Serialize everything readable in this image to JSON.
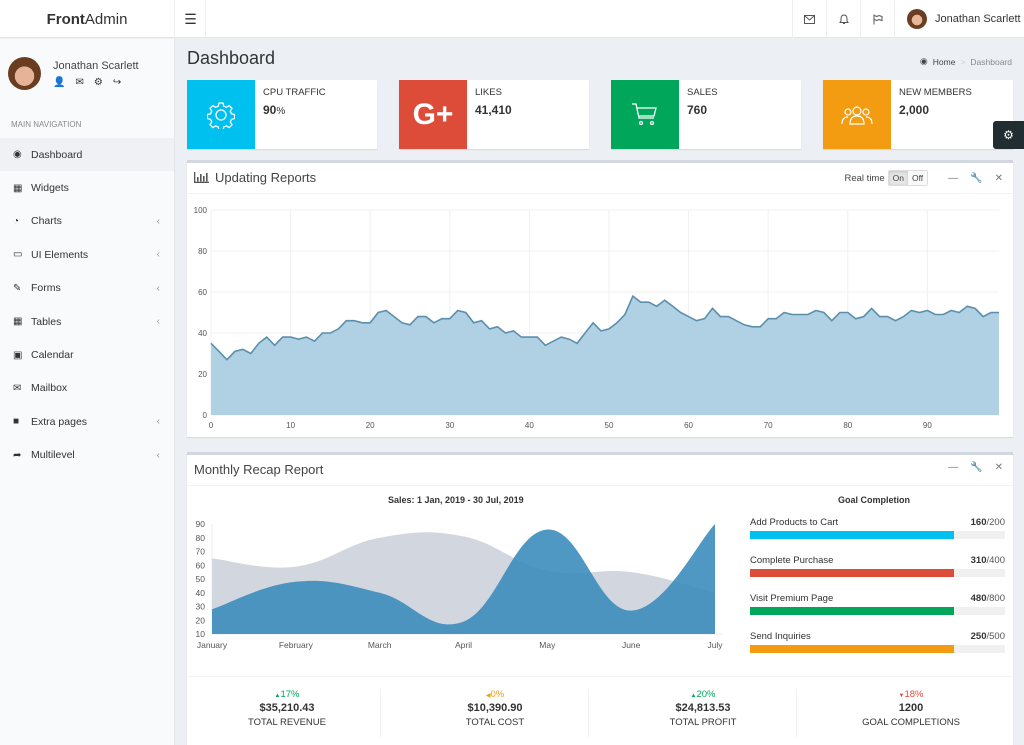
{
  "app": {
    "brand_bold": "Front",
    "brand_light": "Admin"
  },
  "topbar": {
    "menu_icon": "hamburger-icon",
    "icons": [
      "envelope-icon",
      "bell-icon",
      "flag-icon"
    ],
    "user_name": "Jonathan Scarlett"
  },
  "sidebar": {
    "user_name": "Jonathan Scarlett",
    "user_actions": [
      "user-icon",
      "envelope-icon",
      "gear-icon",
      "sign-out-icon"
    ],
    "nav_header": "MAIN NAVIGATION",
    "items": [
      {
        "label": "Dashboard",
        "icon": "dashboard-icon",
        "active": true,
        "has_children": false
      },
      {
        "label": "Widgets",
        "icon": "th-icon",
        "active": false,
        "has_children": false
      },
      {
        "label": "Charts",
        "icon": "pie-chart-icon",
        "active": false,
        "has_children": true
      },
      {
        "label": "UI Elements",
        "icon": "laptop-icon",
        "active": false,
        "has_children": true
      },
      {
        "label": "Forms",
        "icon": "edit-icon",
        "active": false,
        "has_children": true
      },
      {
        "label": "Tables",
        "icon": "table-icon",
        "active": false,
        "has_children": true
      },
      {
        "label": "Calendar",
        "icon": "calendar-icon",
        "active": false,
        "has_children": false
      },
      {
        "label": "Mailbox",
        "icon": "envelope-icon",
        "active": false,
        "has_children": false
      },
      {
        "label": "Extra pages",
        "icon": "folder-icon",
        "active": false,
        "has_children": true
      },
      {
        "label": "Multilevel",
        "icon": "share-icon",
        "active": false,
        "has_children": true
      }
    ]
  },
  "page": {
    "title": "Dashboard",
    "breadcrumb": [
      {
        "label": "Home",
        "icon": "dashboard-icon"
      },
      {
        "label": "Dashboard"
      }
    ]
  },
  "info_boxes": [
    {
      "label": "CPU TRAFFIC",
      "value": "90",
      "unit": "%",
      "icon": "gear-icon",
      "color": "#00c0ef"
    },
    {
      "label": "LIKES",
      "value": "41,410",
      "unit": "",
      "icon": "google-plus-icon",
      "color": "#dd4b39"
    },
    {
      "label": "SALES",
      "value": "760",
      "unit": "",
      "icon": "cart-icon",
      "color": "#00a65a"
    },
    {
      "label": "NEW MEMBERS",
      "value": "2,000",
      "unit": "",
      "icon": "users-icon",
      "color": "#f39c12"
    }
  ],
  "updating_reports": {
    "title": "Updating Reports",
    "realtime_label": "Real time",
    "toggle_on": "On",
    "toggle_off": "Off",
    "toggle_state": "On"
  },
  "monthly_recap": {
    "title": "Monthly Recap Report",
    "goal_title": "Goal Completion",
    "goals": [
      {
        "label": "Add Products to Cart",
        "done": "160",
        "total": "200",
        "progress_pct": 80,
        "color": "#00c0ef"
      },
      {
        "label": "Complete Purchase",
        "done": "310",
        "total": "400",
        "progress_pct": 80,
        "color": "#dd4b39"
      },
      {
        "label": "Visit Premium Page",
        "done": "480",
        "total": "800",
        "progress_pct": 80,
        "color": "#00a65a"
      },
      {
        "label": "Send Inquiries",
        "done": "250",
        "total": "500",
        "progress_pct": 80,
        "color": "#f39c12"
      }
    ],
    "stats": [
      {
        "pct": "17%",
        "direction": "up",
        "color": "#00a65a",
        "amount": "$35,210.43",
        "label": "TOTAL REVENUE"
      },
      {
        "pct": "0%",
        "direction": "left",
        "color": "#f39c12",
        "amount": "$10,390.90",
        "label": "TOTAL COST"
      },
      {
        "pct": "20%",
        "direction": "up",
        "color": "#00a65a",
        "amount": "$24,813.53",
        "label": "TOTAL PROFIT"
      },
      {
        "pct": "18%",
        "direction": "down",
        "color": "#dd4b39",
        "amount": "1200",
        "label": "GOAL COMPLETIONS"
      }
    ]
  },
  "chart_data": [
    {
      "type": "area",
      "title": "Updating Reports",
      "xlabel": "",
      "ylabel": "",
      "xlim": [
        0,
        99
      ],
      "ylim": [
        0,
        100
      ],
      "x_ticks": [
        0,
        10,
        20,
        30,
        40,
        50,
        60,
        70,
        80,
        90
      ],
      "y_ticks": [
        0,
        20,
        40,
        60,
        80,
        100
      ],
      "grid": true,
      "fill_color": "#b0d0e4",
      "line_color": "#5b8fae",
      "series": [
        {
          "name": "realtime",
          "values": [
            35,
            31,
            27,
            31,
            32,
            30,
            35,
            38,
            34,
            38,
            38,
            37,
            38,
            36,
            40,
            40,
            42,
            46,
            46,
            45,
            45,
            50,
            51,
            48,
            45,
            44,
            48,
            48,
            45,
            47,
            47,
            51,
            50,
            45,
            46,
            42,
            43,
            40,
            41,
            38,
            38,
            38,
            34,
            36,
            38,
            37,
            35,
            40,
            45,
            41,
            42,
            45,
            49,
            58,
            55,
            55,
            53,
            56,
            53,
            50,
            48,
            46,
            47,
            52,
            48,
            48,
            46,
            44,
            43,
            43,
            47,
            47,
            50,
            49,
            49,
            49,
            51,
            50,
            46,
            50,
            50,
            47,
            48,
            52,
            48,
            48,
            46,
            48,
            51,
            50,
            51,
            49,
            49,
            51,
            50,
            53,
            52,
            48,
            50,
            50
          ]
        }
      ]
    },
    {
      "type": "area",
      "title": "Sales: 1 Jan, 2019 - 30 Jul, 2019",
      "categories": [
        "January",
        "February",
        "March",
        "April",
        "May",
        "June",
        "July"
      ],
      "ylim": [
        10,
        90
      ],
      "y_ticks": [
        10,
        20,
        30,
        40,
        50,
        60,
        70,
        80,
        90
      ],
      "legend": "none",
      "series": [
        {
          "name": "Series 1",
          "values": [
            65,
            59,
            80,
            81,
            56,
            55,
            40
          ],
          "color": "#d2d6de"
        },
        {
          "name": "Series 2",
          "values": [
            28,
            48,
            40,
            19,
            86,
            27,
            90
          ],
          "color": "#3c8dbc"
        }
      ]
    }
  ]
}
